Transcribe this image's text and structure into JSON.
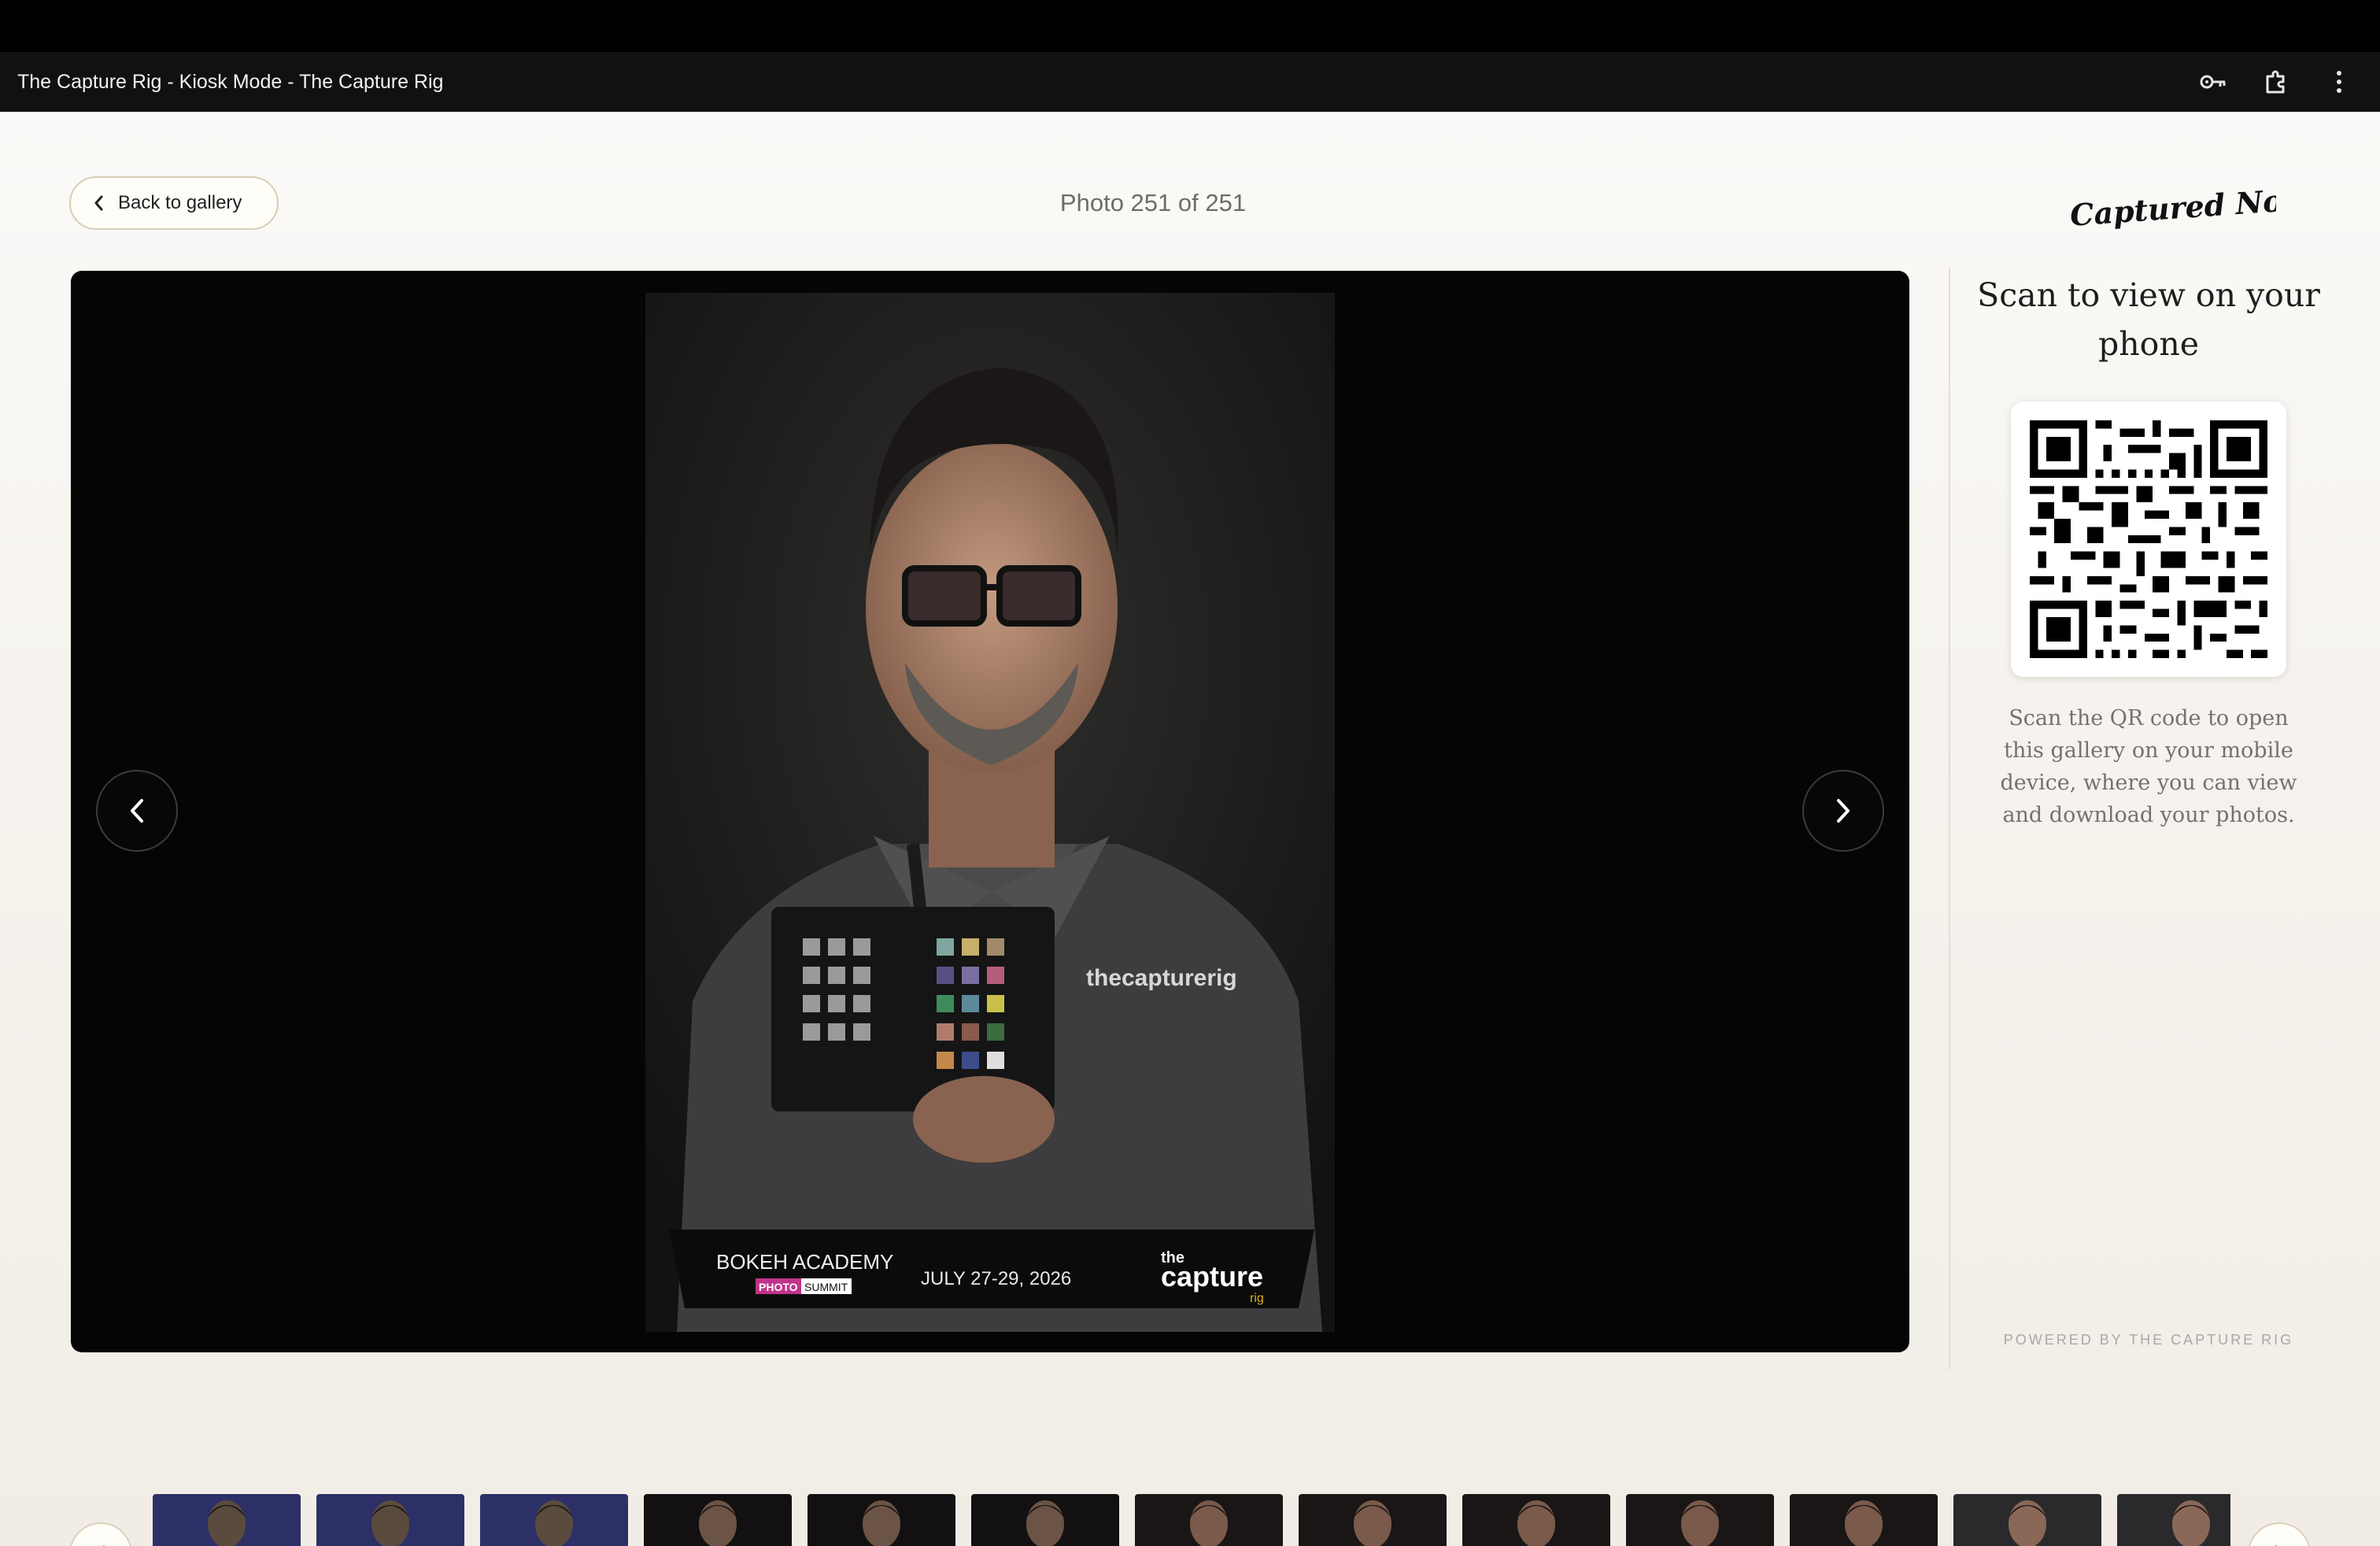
{
  "window": {
    "title": "The Capture Rig - Kiosk Mode - The Capture Rig",
    "actions": [
      {
        "icon": "key-icon"
      },
      {
        "icon": "extension-puzzle-icon"
      },
      {
        "icon": "more-vertical-icon"
      }
    ]
  },
  "header": {
    "back_label": "Back to gallery",
    "photo_counter": "Photo 251 of 251",
    "brand": "Captured Now"
  },
  "viewer": {
    "photo_alt": "Portrait of a man in glasses wearing a grey polo, holding a color checker card",
    "shirt_logo": "thecapturerig",
    "banner": {
      "event": "BOKEH ACADEMY",
      "event_sub_1": "PHOTO",
      "event_sub_2": "SUMMIT",
      "dates": "JULY 27-29, 2026",
      "sponsor_top": "the",
      "sponsor_main": "capture",
      "sponsor_sub": "rig"
    }
  },
  "sidebar": {
    "heading": "Scan to view on your phone",
    "description": "Scan the QR code to open this gallery on your mobile device, where you can view and download your photos.",
    "powered_by": "POWERED BY THE CAPTURE RIG"
  },
  "filmstrip": {
    "thumbs": [
      {
        "tone": "blue"
      },
      {
        "tone": "blue"
      },
      {
        "tone": "blue"
      },
      {
        "tone": "dark"
      },
      {
        "tone": "dark"
      },
      {
        "tone": "dark"
      },
      {
        "tone": "portrait"
      },
      {
        "tone": "portrait"
      },
      {
        "tone": "portrait"
      },
      {
        "tone": "portrait"
      },
      {
        "tone": "portrait"
      },
      {
        "tone": "grey"
      },
      {
        "tone": "grey"
      }
    ]
  },
  "colors": {
    "accent_border": "#d8cdb4",
    "viewer_bg": "#050505",
    "titlebar_bg": "#121110"
  }
}
